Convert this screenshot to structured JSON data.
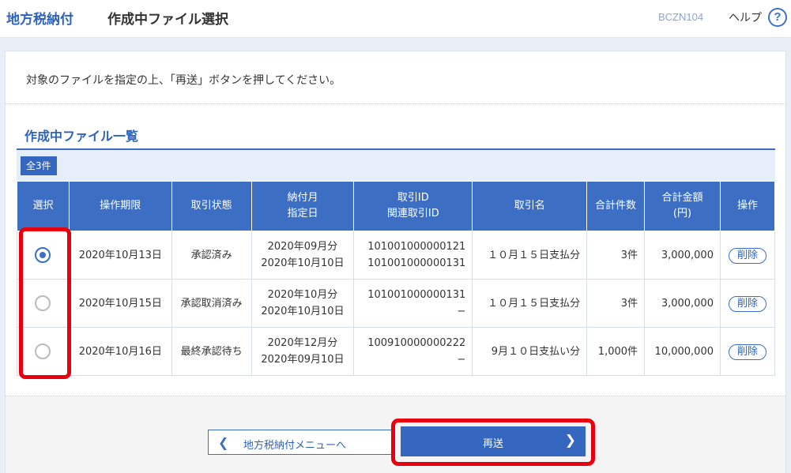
{
  "header": {
    "app_title": "地方税納付",
    "page_title": "作成中ファイル選択",
    "screen_id": "BCZN104",
    "help_label": "ヘルプ",
    "help_icon": "?"
  },
  "instruction": "対象のファイルを指定の上、「再送」ボタンを押してください。",
  "section_title": "作成中ファイル一覧",
  "count_badge": "全3件",
  "table": {
    "headers": {
      "select": "選択",
      "deadline": "操作期限",
      "status": "取引状態",
      "month_line1": "納付月",
      "month_line2": "指定日",
      "id_line1": "取引ID",
      "id_line2": "関連取引ID",
      "name": "取引名",
      "count": "合計件数",
      "amount_line1": "合計金額",
      "amount_line2": "(円)",
      "action": "操作"
    },
    "rows": [
      {
        "selected": true,
        "deadline": "2020年10月13日",
        "status": "承認済み",
        "month": "2020年09月分",
        "date": "2020年10月10日",
        "id": "101001000000121",
        "related_id": "101001000000131",
        "name": "１０月１５日支払分",
        "count": "3件",
        "amount": "3,000,000",
        "action": "削除"
      },
      {
        "selected": false,
        "deadline": "2020年10月15日",
        "status": "承認取消済み",
        "month": "2020年10月分",
        "date": "2020年10月10日",
        "id": "101001000000131",
        "related_id": "−",
        "name": "１０月１５日支払分",
        "count": "3件",
        "amount": "3,000,000",
        "action": "削除"
      },
      {
        "selected": false,
        "deadline": "2020年10月16日",
        "status": "最終承認待ち",
        "month": "2020年12月分",
        "date": "2020年09月10日",
        "id": "100910000000222",
        "related_id": "−",
        "name": "9月１０日支払い分",
        "count": "1,000件",
        "amount": "10,000,000",
        "action": "削除"
      }
    ]
  },
  "buttons": {
    "back_label": "地方税納付メニューへ",
    "back_icon": "chevron-left-icon",
    "resend_label": "再送",
    "resend_icon": "chevron-right-icon"
  },
  "colors": {
    "accent": "#3c6fc3",
    "highlight": "#e8000e"
  }
}
